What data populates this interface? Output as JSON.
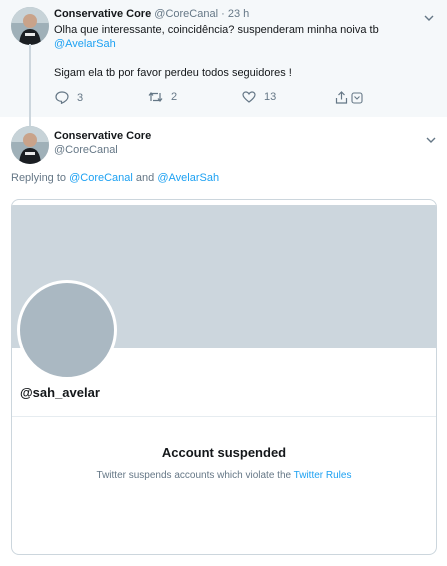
{
  "tweet": {
    "name": "Conservative Core",
    "handle": "@CoreCanal",
    "separator": "·",
    "time": "23 h",
    "line1": "Olha que interessante, coincidência? suspenderam minha noiva tb",
    "mention": "@AvelarSah",
    "line3": "Sigam ela tb por favor perdeu todos seguidores  !",
    "replies": "3",
    "retweets": "2",
    "likes": "13",
    "icons": [
      "reply-icon",
      "retweet-icon",
      "like-icon",
      "share-icon",
      "chevron-down-icon"
    ]
  },
  "reply": {
    "name": "Conservative Core",
    "handle": "@CoreCanal",
    "replying_prefix": "Replying to",
    "replying_to_1": "@CoreCanal",
    "replying_and": "and",
    "replying_to_2": "@AvelarSah"
  },
  "card": {
    "handle": "@sah_avelar",
    "title": "Account suspended",
    "subtitle": "Twitter suspends accounts which violate the",
    "link": "Twitter Rules"
  },
  "colors": {
    "accent": "#1da1f2",
    "secondary_text": "#657786",
    "banner": "#ccd6dd",
    "avatar_placeholder": "#aab8c2"
  }
}
